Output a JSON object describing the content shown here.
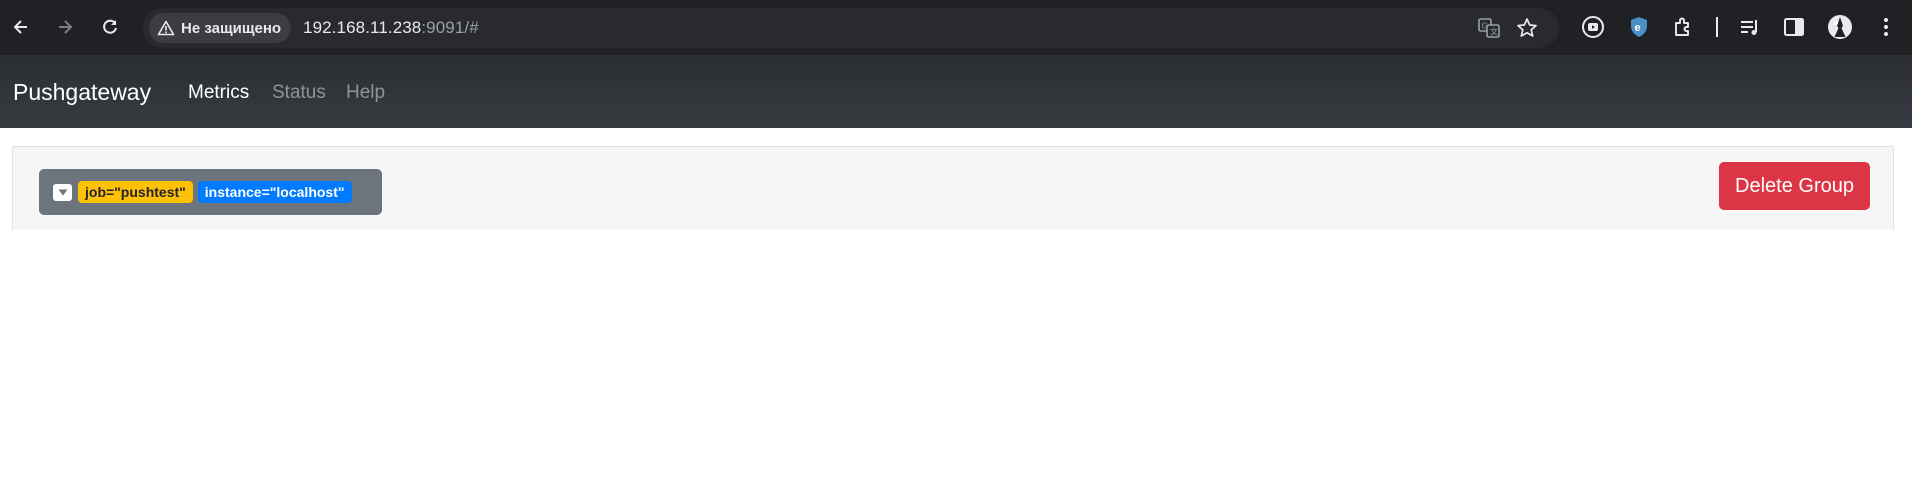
{
  "browser": {
    "security_label": "Не защищено",
    "url_host": "192.168.11.238",
    "url_rest": ":9091/#",
    "icons": [
      "back-icon",
      "forward-icon",
      "reload-icon",
      "warning-icon",
      "translate-icon",
      "star-icon",
      "youtube-extension-icon",
      "shield-extension-icon",
      "extensions-icon",
      "media-queue-icon",
      "side-panel-icon",
      "profile-avatar",
      "menu-icon"
    ]
  },
  "navbar": {
    "brand": "Pushgateway",
    "links": [
      {
        "label": "Metrics",
        "active": true
      },
      {
        "label": "Status",
        "active": false
      },
      {
        "label": "Help",
        "active": false
      }
    ]
  },
  "group": {
    "labels": [
      {
        "key": "job",
        "value": "\"pushtest\"",
        "text": "job=\"pushtest\""
      },
      {
        "key": "instance",
        "value": "\"localhost\"",
        "text": "instance=\"localhost\""
      }
    ],
    "delete_label": "Delete Group"
  },
  "colors": {
    "chrome_bg": "#202124",
    "navbar_bg": "#343a40",
    "group_toggle": "#6c757d",
    "job_badge": "#ffc107",
    "instance_badge": "#007bff",
    "delete_button": "#dc3545"
  }
}
